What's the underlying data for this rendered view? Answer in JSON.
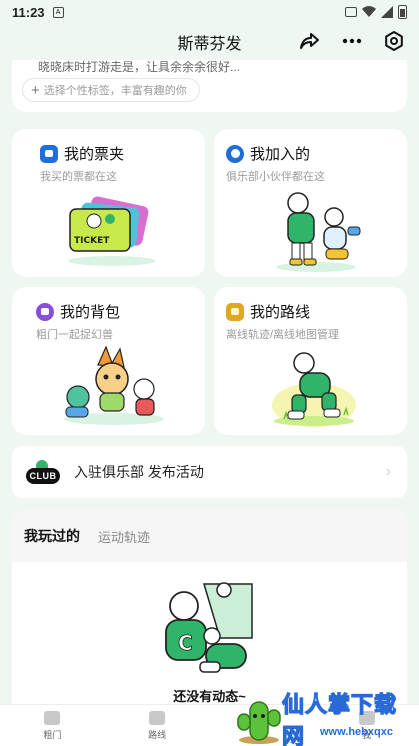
{
  "status_bar": {
    "time": "11:23",
    "notif_glyph": "A"
  },
  "header": {
    "title": "斯蒂芬发"
  },
  "profile": {
    "bio": "晓晓床时打游走是，让具余余余很好...",
    "tag_placeholder": "选择个性标签，丰富有趣的你"
  },
  "cards": {
    "tickets": {
      "title": "我的票夹",
      "subtitle": "我买的票都在这",
      "icon": "ticket-icon",
      "color": "#1f6fd8"
    },
    "joined": {
      "title": "我加入的",
      "subtitle": "俱乐部小伙伴都在这",
      "icon": "smile-icon",
      "color": "#1f6fd8"
    },
    "backpack": {
      "title": "我的背包",
      "subtitle": "粗门一起捉幻兽",
      "icon": "backpack-icon",
      "color": "#8b4fd6"
    },
    "routes": {
      "title": "我的路线",
      "subtitle": "离线轨迹/离线地图管理",
      "icon": "map-icon",
      "color": "#e0a81e"
    }
  },
  "club_bar": {
    "logo_text": "CLUB",
    "text": "入驻俱乐部 发布活动"
  },
  "played": {
    "tab_active": "我玩过的",
    "tab_inactive": "运动轨迹",
    "empty_text": "还没有动态~"
  },
  "tabbar": {
    "items": [
      {
        "label": "粗门"
      },
      {
        "label": "路线"
      },
      {
        "label": ""
      },
      {
        "label": "我"
      }
    ]
  },
  "watermark": {
    "text": "仙人掌下载网",
    "sub": "www.hebxqxc"
  }
}
